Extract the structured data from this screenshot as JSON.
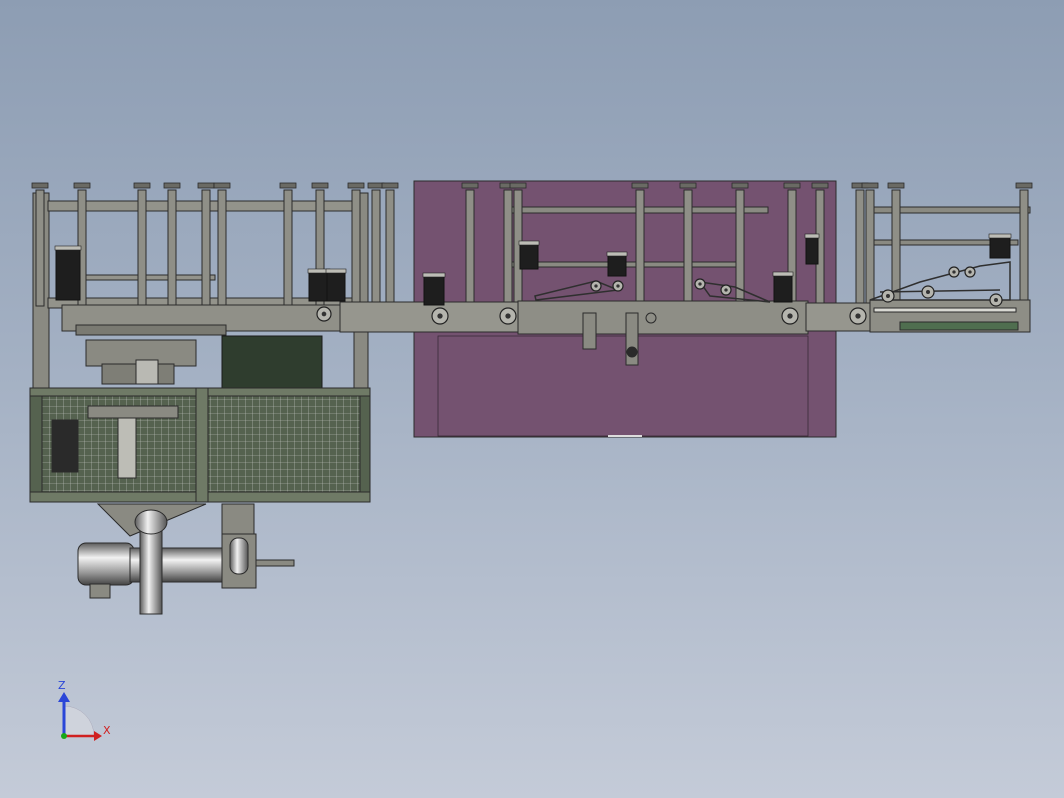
{
  "view": {
    "background_top": "#8d9db3",
    "background_bottom": "#c4cbd8",
    "line_color": "#2b2b2b",
    "frame_fill": "#8a8a82",
    "panel_purple": "#745270",
    "guard_fill": "#4d5c4a",
    "motor_fill": "#1e1e1e"
  },
  "triad": {
    "z_label": "Z",
    "x_label": "X",
    "z_color": "#2a46d8",
    "x_color": "#d02020",
    "y_color": "#18a818"
  }
}
